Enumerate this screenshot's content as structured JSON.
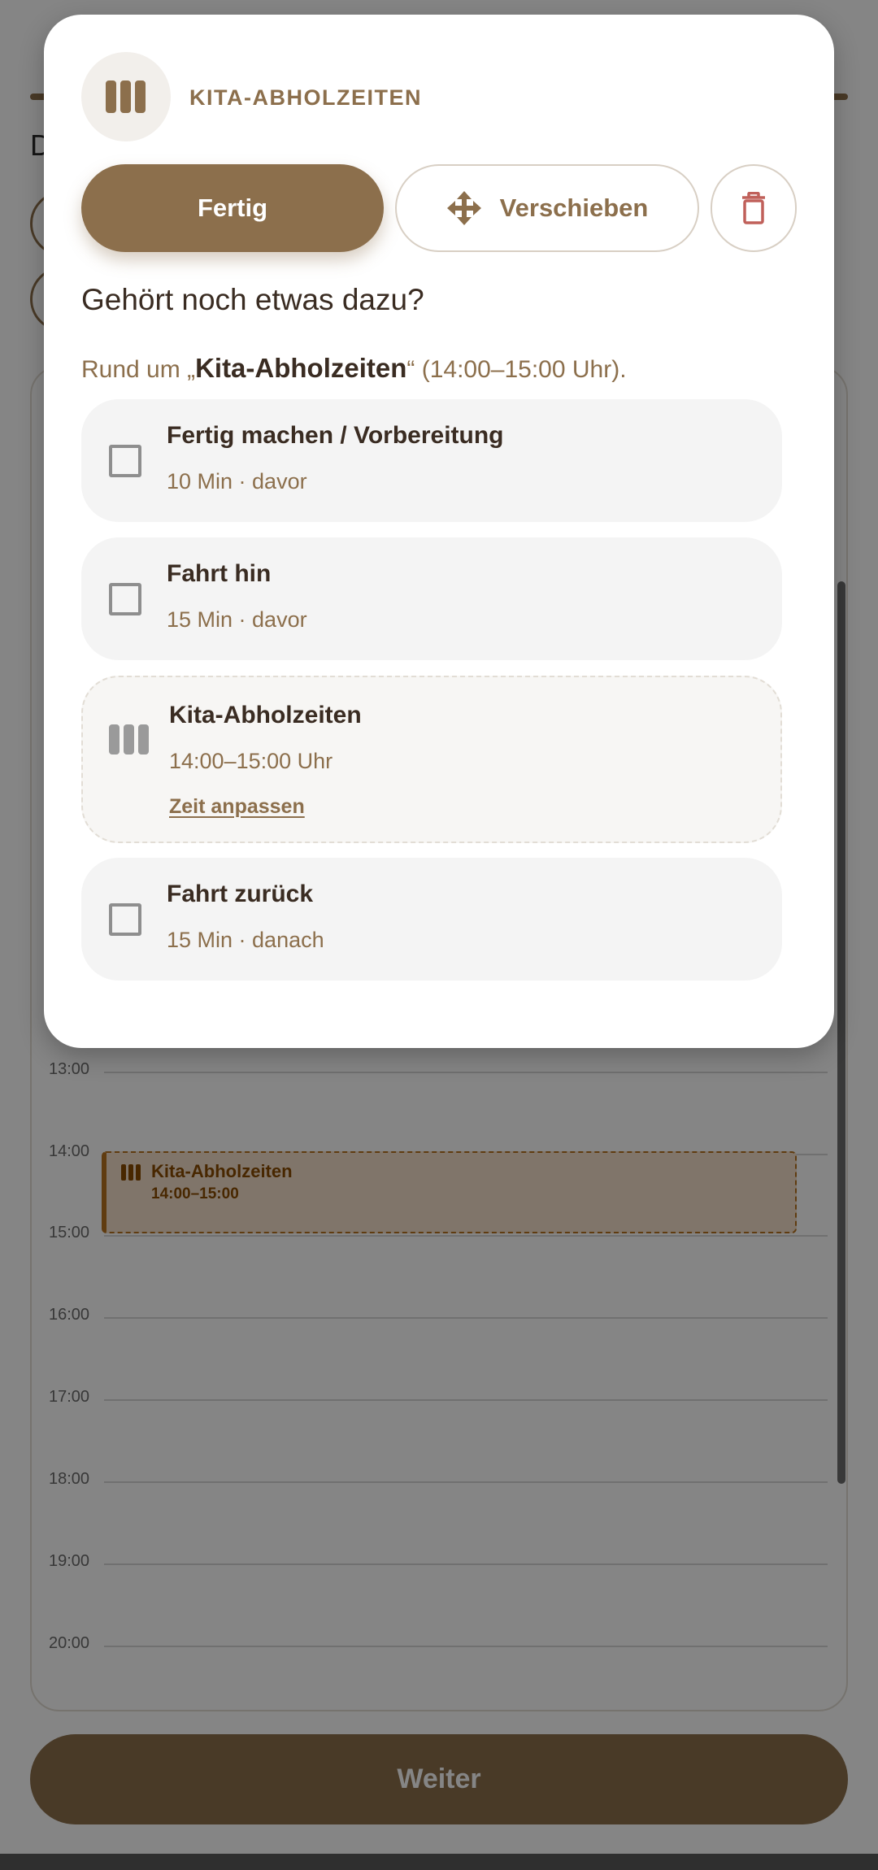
{
  "background": {
    "header_letter": "D",
    "calendar": {
      "hours": [
        "13:00",
        "14:00",
        "15:00",
        "16:00",
        "17:00",
        "18:00",
        "19:00",
        "20:00"
      ],
      "event": {
        "title": "Kita-Abholzeiten",
        "time": "14:00–15:00",
        "start": "14:00",
        "end": "15:00"
      }
    },
    "continue_label": "Weiter"
  },
  "modal": {
    "icon": "columns-icon",
    "title": "KITA-ABHOLZEITEN",
    "done_label": "Fertig",
    "move_label": "Verschieben",
    "move_icon": "move-arrows-icon",
    "delete_icon": "trash-icon",
    "heading": "Gehört noch etwas dazu?",
    "subtitle_prefix": "Rund um „",
    "subtitle_name": "Kita-Abholzeiten",
    "subtitle_suffix": "“ (14:00–15:00 Uhr).",
    "items": [
      {
        "title": "Fertig machen / Vorbereitung",
        "meta": "10 Min · davor",
        "checked": false
      },
      {
        "title": "Fahrt hin",
        "meta": "15 Min · davor",
        "checked": false
      },
      {
        "title": "Kita-Abholzeiten",
        "meta": "14:00–15:00 Uhr",
        "link": "Zeit anpassen",
        "anchor": true
      },
      {
        "title": "Fahrt zurück",
        "meta": "15 Min · danach",
        "checked": false
      }
    ]
  },
  "colors": {
    "accent": "#8c6f4c",
    "text_dark": "#3a2c22",
    "delete": "#c0605a",
    "event_fill": "#f6e1cc",
    "event_border": "#b9731f"
  }
}
